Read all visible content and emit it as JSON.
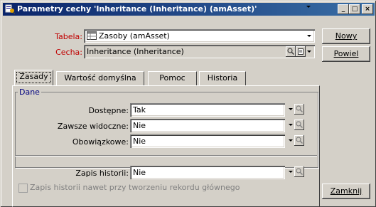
{
  "window": {
    "title": "Parametry cechy 'Inheritance (Inheritance) (amAsset)'",
    "controls": {
      "minimize": "_",
      "maximize": "□",
      "close": "×"
    }
  },
  "form": {
    "table_label": "Tabela:",
    "table_value": "Zasoby (amAsset)",
    "feature_label": "Cecha:",
    "feature_value": "Inheritance (Inheritance)"
  },
  "buttons": {
    "new": "Nowy",
    "duplicate": "Powiel",
    "close": "Zamknij"
  },
  "tabs": [
    {
      "label": "Zasady",
      "active": true
    },
    {
      "label": "Wartość domyślna",
      "active": false
    },
    {
      "label": "Pomoc",
      "active": false
    },
    {
      "label": "Historia",
      "active": false
    }
  ],
  "group": {
    "title": "Dane",
    "fields": [
      {
        "label": "Dostępne:",
        "value": "Tak"
      },
      {
        "label": "Zawsze widoczne:",
        "value": "Nie"
      },
      {
        "label": "Obowiązkowe:",
        "value": "Nie"
      }
    ]
  },
  "history": {
    "label": "Zapis historii:",
    "value": "Nie",
    "checkbox_label": "Zapis historii nawet przy tworzeniu rekordu głównego"
  },
  "colors": {
    "titlebar_start": "#0a246a",
    "titlebar_end": "#3a6ea5",
    "required_label": "#c00000",
    "face": "#d4d0c8"
  },
  "icons": [
    "app-icon",
    "table-icon",
    "search-icon",
    "dropdown-arrow-icon",
    "list-icon"
  ]
}
